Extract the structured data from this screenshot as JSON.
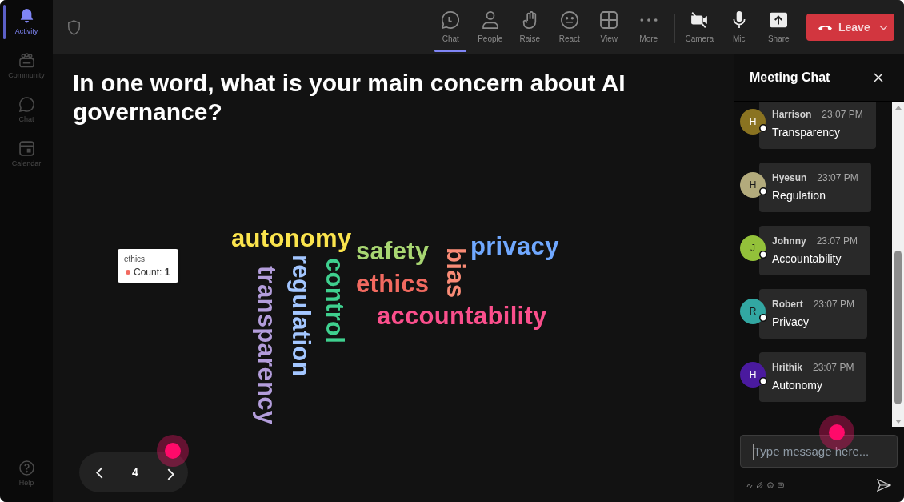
{
  "sidebar": {
    "items": [
      {
        "label": "Activity",
        "selected": true
      },
      {
        "label": "Community",
        "selected": false
      },
      {
        "label": "Chat",
        "selected": false
      },
      {
        "label": "Calendar",
        "selected": false
      }
    ],
    "help": {
      "label": "Help"
    }
  },
  "toolbar": {
    "meeting_buttons": [
      {
        "label": "Chat",
        "selected": true
      },
      {
        "label": "People",
        "selected": false
      },
      {
        "label": "Raise",
        "selected": false
      },
      {
        "label": "React",
        "selected": false
      },
      {
        "label": "View",
        "selected": false
      },
      {
        "label": "More",
        "selected": false
      }
    ],
    "device_buttons": [
      {
        "label": "Camera"
      },
      {
        "label": "Mic"
      },
      {
        "label": "Share"
      }
    ],
    "leave_button": {
      "label": "Leave"
    }
  },
  "poll": {
    "question": "In one word, what is your main concern about AI governance?",
    "word_cloud": {
      "words": [
        {
          "text": "autonomy",
          "color": "#fbe44d",
          "kind": "horizontal"
        },
        {
          "text": "safety",
          "color": "#a8d672",
          "kind": "horizontal"
        },
        {
          "text": "bias",
          "color": "#f98b76",
          "kind": "vertical"
        },
        {
          "text": "privacy",
          "color": "#70a8ff",
          "kind": "horizontal"
        },
        {
          "text": "transparency",
          "color": "#b39ddb",
          "kind": "vertical"
        },
        {
          "text": "regulation",
          "color": "#a3c6ff",
          "kind": "vertical"
        },
        {
          "text": "control",
          "color": "#3fd08f",
          "kind": "vertical"
        },
        {
          "text": "ethics",
          "color": "#f26a60",
          "kind": "horizontal",
          "tooltip": {
            "title": "ethics",
            "label": "Count: **1**"
          }
        },
        {
          "text": "accountability",
          "color": "#fb4f8c",
          "kind": "horizontal"
        }
      ]
    },
    "pager": {
      "page": "4"
    }
  },
  "chat": {
    "title": "Meeting Chat",
    "messages": [
      {
        "author": "Harrison",
        "initial": "H",
        "color": "#8a7321",
        "time": "23:07 PM",
        "text": "Transparency"
      },
      {
        "author": "Hyesun",
        "initial": "H",
        "color": "#b3ab7c",
        "time": "23:07 PM",
        "text": "Regulation"
      },
      {
        "author": "Johnny",
        "initial": "J",
        "color": "#93c13a",
        "time": "23:07 PM",
        "text": "Accountability"
      },
      {
        "author": "Robert",
        "initial": "R",
        "color": "#32a7a2",
        "time": "23:07 PM",
        "text": "Privacy"
      },
      {
        "author": "Hrithik",
        "initial": "H",
        "color": "#4a1a9e",
        "time": "23:07 PM",
        "text": "Autonomy"
      }
    ],
    "input": {
      "placeholder": "Type message here..."
    }
  }
}
